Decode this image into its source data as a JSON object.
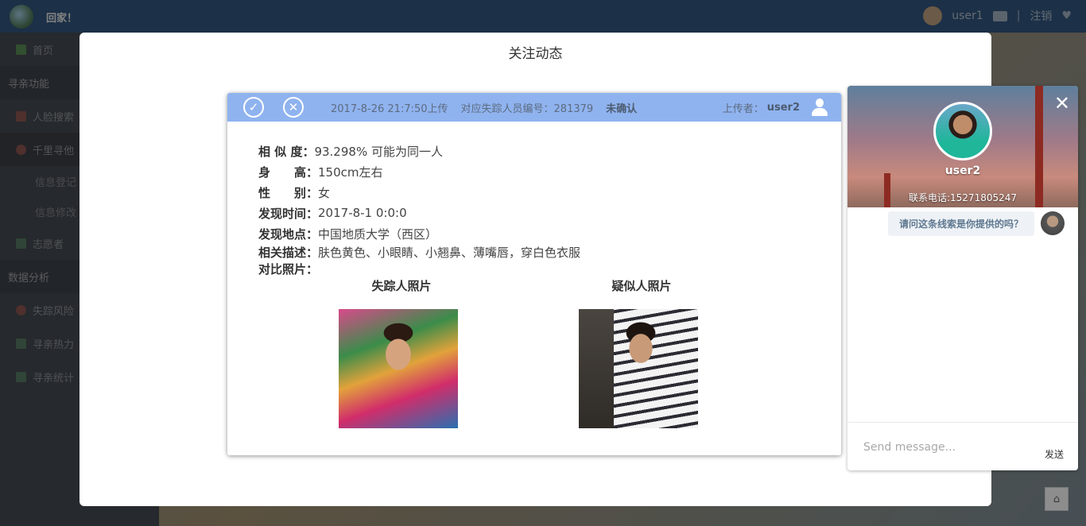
{
  "app": {
    "brand": "回家！",
    "user": "user1",
    "logout": "注销"
  },
  "sidebar": {
    "home": "首页",
    "cat_search": "寻亲功能",
    "face_search": "人脸搜索",
    "thousand": "千里寻他",
    "info_register": "信息登记",
    "info_edit": "信息修改",
    "volunteer": "志愿者",
    "cat_data": "数据分析",
    "risk": "失踪风险",
    "heat": "寻亲热力",
    "stats": "寻亲统计"
  },
  "modal": {
    "title": "关注动态"
  },
  "card": {
    "upload_time": "2017-8-26 21:7:50上传",
    "case_number": "对应失踪人员编号：281379",
    "status": "未确认",
    "uploader_label": "上传者：",
    "uploader": "user2",
    "fields": [
      {
        "label": "相 似 度：",
        "value": "93.298%  可能为同一人"
      },
      {
        "label": "身　　高：",
        "value": "150cm左右"
      },
      {
        "label": "性　　别：",
        "value": "女"
      },
      {
        "label": "发现时间：",
        "value": "2017-8-1 0:0:0"
      },
      {
        "label": "发现地点：",
        "value": "中国地质大学（西区）"
      },
      {
        "label": "相关描述：",
        "value": "肤色黄色、小眼睛、小翘鼻、薄嘴唇，穿白色衣服"
      },
      {
        "label": "对比照片：",
        "value": ""
      }
    ],
    "photo_missing_label": "失踪人照片",
    "photo_suspect_label": "疑似人照片"
  },
  "chat": {
    "name": "user2",
    "phone": "联系电话:15271805247",
    "message": "请问这条线索是你提供的吗？",
    "placeholder": "Send message...",
    "send": "发送"
  },
  "colors": {
    "card_header": "#8fb3ef",
    "topbar": "#2c4b6e",
    "sidebar": "#3b3f45"
  }
}
